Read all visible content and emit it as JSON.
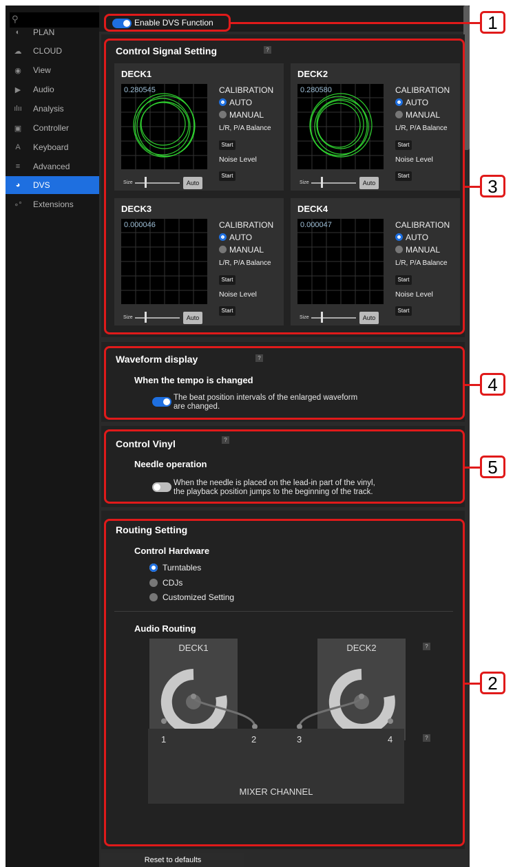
{
  "sidebar": {
    "items": [
      {
        "label": "PLAN",
        "icon": "plan-icon",
        "glyph": "◐"
      },
      {
        "label": "CLOUD",
        "icon": "cloud-icon",
        "glyph": "☁"
      },
      {
        "label": "View",
        "icon": "eye-icon",
        "glyph": "◉"
      },
      {
        "label": "Audio",
        "icon": "speaker-icon",
        "glyph": "▶"
      },
      {
        "label": "Analysis",
        "icon": "waveform-icon",
        "glyph": "ılıı"
      },
      {
        "label": "Controller",
        "icon": "controller-icon",
        "glyph": "▣"
      },
      {
        "label": "Keyboard",
        "icon": "keyboard-icon",
        "glyph": "A"
      },
      {
        "label": "Advanced",
        "icon": "list-icon",
        "glyph": "≡"
      },
      {
        "label": "DVS",
        "icon": "dvs-icon",
        "glyph": "◕",
        "active": true
      },
      {
        "label": "Extensions",
        "icon": "extensions-icon",
        "glyph": "∘°"
      }
    ]
  },
  "enable_dvs": {
    "label": "Enable DVS Function",
    "on": true
  },
  "control_signal": {
    "title": "Control Signal Setting",
    "help": "?",
    "decks": [
      {
        "name": "DECK1",
        "value": "0.280545",
        "calibration": "CALIBRATION",
        "auto": "AUTO",
        "manual": "MANUAL",
        "balance": "L/R, P/A Balance",
        "start": "Start",
        "noise": "Noise Level",
        "size": "Size",
        "auto_btn": "Auto"
      },
      {
        "name": "DECK2",
        "value": "0.280580",
        "calibration": "CALIBRATION",
        "auto": "AUTO",
        "manual": "MANUAL",
        "balance": "L/R, P/A Balance",
        "start": "Start",
        "noise": "Noise Level",
        "size": "Size",
        "auto_btn": "Auto"
      },
      {
        "name": "DECK3",
        "value": "0.000046",
        "calibration": "CALIBRATION",
        "auto": "AUTO",
        "manual": "MANUAL",
        "balance": "L/R, P/A Balance",
        "start": "Start",
        "noise": "Noise Level",
        "size": "Size",
        "auto_btn": "Auto"
      },
      {
        "name": "DECK4",
        "value": "0.000047",
        "calibration": "CALIBRATION",
        "auto": "AUTO",
        "manual": "MANUAL",
        "balance": "L/R, P/A Balance",
        "start": "Start",
        "noise": "Noise Level",
        "size": "Size",
        "auto_btn": "Auto"
      }
    ]
  },
  "waveform": {
    "title": "Waveform display",
    "help": "?",
    "subtitle": "When the tempo is changed",
    "option_line1": "The beat position intervals of the enlarged waveform",
    "option_line2": "are changed.",
    "on": true
  },
  "control_vinyl": {
    "title": "Control Vinyl",
    "help": "?",
    "subtitle": "Needle operation",
    "option_line1": "When the needle is placed on the lead-in part of the vinyl,",
    "option_line2": "the playback position jumps to the beginning of the track.",
    "on": false
  },
  "routing": {
    "title": "Routing Setting",
    "hardware_title": "Control Hardware",
    "options": [
      "Turntables",
      "CDJs",
      "Customized Setting"
    ],
    "selected": "Turntables",
    "audio_title": "Audio Routing",
    "deck_left": "DECK1",
    "deck_right": "DECK2",
    "help": "?",
    "channels": [
      "1",
      "2",
      "3",
      "4"
    ],
    "mixer_label": "MIXER CHANNEL"
  },
  "reset_label": "Reset to defaults",
  "callouts": [
    "1",
    "2",
    "3",
    "4",
    "5"
  ],
  "colors": {
    "accent": "#1e6fe0",
    "annotation": "#e01a1a",
    "scope_trace": "#2fd12f"
  }
}
